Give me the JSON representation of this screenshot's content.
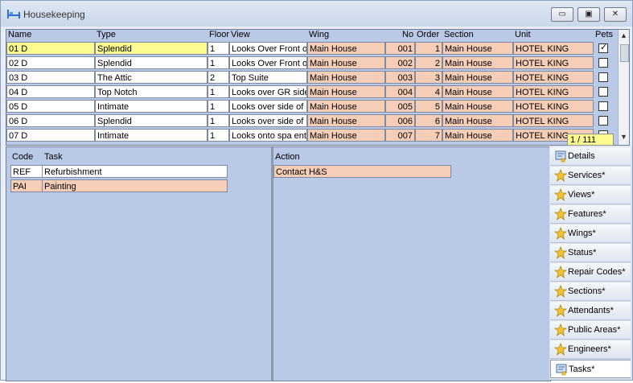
{
  "window": {
    "title": "Housekeeping"
  },
  "grid": {
    "headers": {
      "name": "Name",
      "type": "Type",
      "floor": "Floor",
      "view": "View",
      "wing": "Wing",
      "no": "No",
      "order": "Order",
      "section": "Section",
      "unit": "Unit",
      "pets": "Pets"
    },
    "rows": [
      {
        "name": "01 D",
        "type": "Splendid",
        "floor": "1",
        "view": "Looks Over Front of",
        "wing": "Main House",
        "no": "001",
        "order": "1",
        "section": "Main House",
        "unit": "HOTEL KING",
        "pets": true
      },
      {
        "name": "02 D",
        "type": "Splendid",
        "floor": "1",
        "view": "Looks Over Front of",
        "wing": "Main House",
        "no": "002",
        "order": "2",
        "section": "Main House",
        "unit": "HOTEL KING",
        "pets": false
      },
      {
        "name": "03 D",
        "type": "The Attic",
        "floor": "2",
        "view": "Top Suite",
        "wing": "Main House",
        "no": "003",
        "order": "3",
        "section": "Main House",
        "unit": "HOTEL KING",
        "pets": false
      },
      {
        "name": "04 D",
        "type": "Top Notch",
        "floor": "1",
        "view": "Looks over GR side",
        "wing": "Main House",
        "no": "004",
        "order": "4",
        "section": "Main House",
        "unit": "HOTEL KING",
        "pets": false
      },
      {
        "name": "05 D",
        "type": "Intimate",
        "floor": "1",
        "view": "Looks over side of h",
        "wing": "Main House",
        "no": "005",
        "order": "5",
        "section": "Main House",
        "unit": "HOTEL KING",
        "pets": false
      },
      {
        "name": "06 D",
        "type": "Splendid",
        "floor": "1",
        "view": "Looks over side of h",
        "wing": "Main House",
        "no": "006",
        "order": "6",
        "section": "Main House",
        "unit": "HOTEL KING",
        "pets": false
      },
      {
        "name": "07 D",
        "type": "Intimate",
        "floor": "1",
        "view": "Looks onto spa entr",
        "wing": "Main House",
        "no": "007",
        "order": "7",
        "section": "Main House",
        "unit": "HOTEL KING",
        "pets": false
      }
    ],
    "record_counter": "1 / 111"
  },
  "tasks": {
    "headers": {
      "code": "Code",
      "task": "Task",
      "action": "Action"
    },
    "rows": [
      {
        "code": "REF",
        "task": "Refurbishment"
      },
      {
        "code": "PAI",
        "task": "Painting"
      }
    ],
    "actions": [
      "Contact H&S"
    ]
  },
  "tabs": [
    {
      "label": "Details",
      "icon": "details-icon",
      "active": false
    },
    {
      "label": "Services*",
      "icon": "star-icon",
      "active": false
    },
    {
      "label": "Views*",
      "icon": "star-icon",
      "active": false
    },
    {
      "label": "Features*",
      "icon": "star-icon",
      "active": false
    },
    {
      "label": "Wings*",
      "icon": "star-icon",
      "active": false
    },
    {
      "label": "Status*",
      "icon": "star-icon",
      "active": false
    },
    {
      "label": "Repair Codes*",
      "icon": "star-icon",
      "active": false
    },
    {
      "label": "Sections*",
      "icon": "star-icon",
      "active": false
    },
    {
      "label": "Attendants*",
      "icon": "star-icon",
      "active": false
    },
    {
      "label": "Public Areas*",
      "icon": "star-icon",
      "active": false
    },
    {
      "label": "Engineers*",
      "icon": "star-icon",
      "active": false
    },
    {
      "label": "Tasks*",
      "icon": "tasks-icon",
      "active": true
    }
  ]
}
